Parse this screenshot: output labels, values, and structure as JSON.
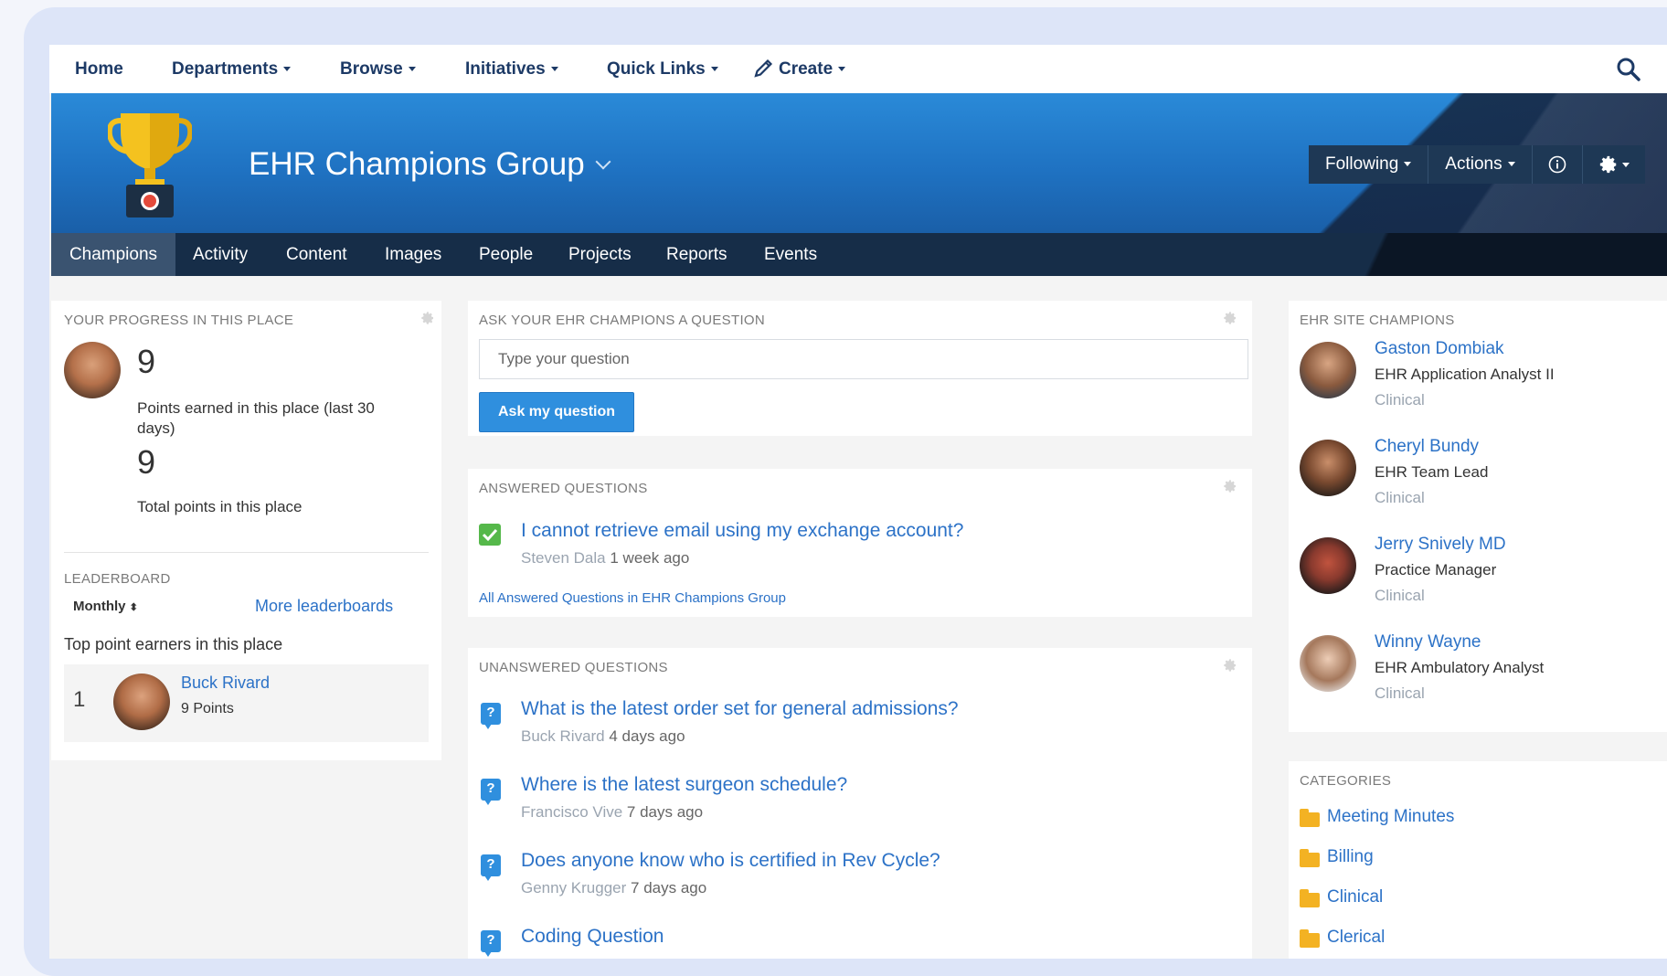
{
  "nav": {
    "home": "Home",
    "departments": "Departments",
    "browse": "Browse",
    "initiatives": "Initiatives",
    "quick_links": "Quick Links",
    "create": "Create"
  },
  "banner": {
    "title": "EHR Champions Group",
    "following": "Following",
    "actions": "Actions"
  },
  "tabs": [
    "Champions",
    "Activity",
    "Content",
    "Images",
    "People",
    "Projects",
    "Reports",
    "Events"
  ],
  "progress": {
    "title": "YOUR PROGRESS IN THIS PLACE",
    "points_30": "9",
    "points_30_label_1": "Points earned in this place (last 30",
    "points_30_label_2": "days)",
    "total_points": "9",
    "total_label": "Total points in this place"
  },
  "leaderboard": {
    "title": "LEADERBOARD",
    "period": "Monthly",
    "more": "More leaderboards",
    "subtitle": "Top point earners in this place",
    "entries": [
      {
        "rank": "1",
        "name": "Buck Rivard",
        "points": "9 Points"
      }
    ]
  },
  "ask": {
    "title": "ASK YOUR EHR CHAMPIONS A QUESTION",
    "placeholder": "Type your question",
    "button": "Ask my question"
  },
  "answered": {
    "title": "ANSWERED QUESTIONS",
    "items": [
      {
        "question": "I cannot retrieve email using my exchange account?",
        "author": "Steven Dala",
        "time": "1 week ago"
      }
    ],
    "all_link": "All Answered Questions in EHR Champions Group"
  },
  "unanswered": {
    "title": "UNANSWERED QUESTIONS",
    "items": [
      {
        "question": "What is the latest order set for general admissions?",
        "author": "Buck Rivard",
        "time": "4 days ago"
      },
      {
        "question": "Where is the latest surgeon schedule?",
        "author": "Francisco Vive",
        "time": "7 days ago"
      },
      {
        "question": "Does anyone know who is certified in Rev Cycle?",
        "author": "Genny Krugger",
        "time": "7 days ago"
      },
      {
        "question": "Coding Question",
        "author": "",
        "time": ""
      }
    ]
  },
  "champions": {
    "title": "EHR SITE CHAMPIONS",
    "people": [
      {
        "name": "Gaston Dombiak",
        "role": "EHR Application Analyst II",
        "dept": "Clinical"
      },
      {
        "name": "Cheryl Bundy",
        "role": "EHR Team Lead",
        "dept": "Clinical"
      },
      {
        "name": "Jerry Snively MD",
        "role": "Practice Manager",
        "dept": "Clinical"
      },
      {
        "name": "Winny Wayne",
        "role": "EHR Ambulatory Analyst",
        "dept": "Clinical"
      }
    ]
  },
  "categories": {
    "title": "CATEGORIES",
    "items": [
      "Meeting Minutes",
      "Billing",
      "Clinical",
      "Clerical"
    ]
  },
  "colors": {
    "accent": "#2f8fde",
    "link": "#2c72c7",
    "banner": "#1f72c2",
    "tabbar": "#162d48"
  }
}
